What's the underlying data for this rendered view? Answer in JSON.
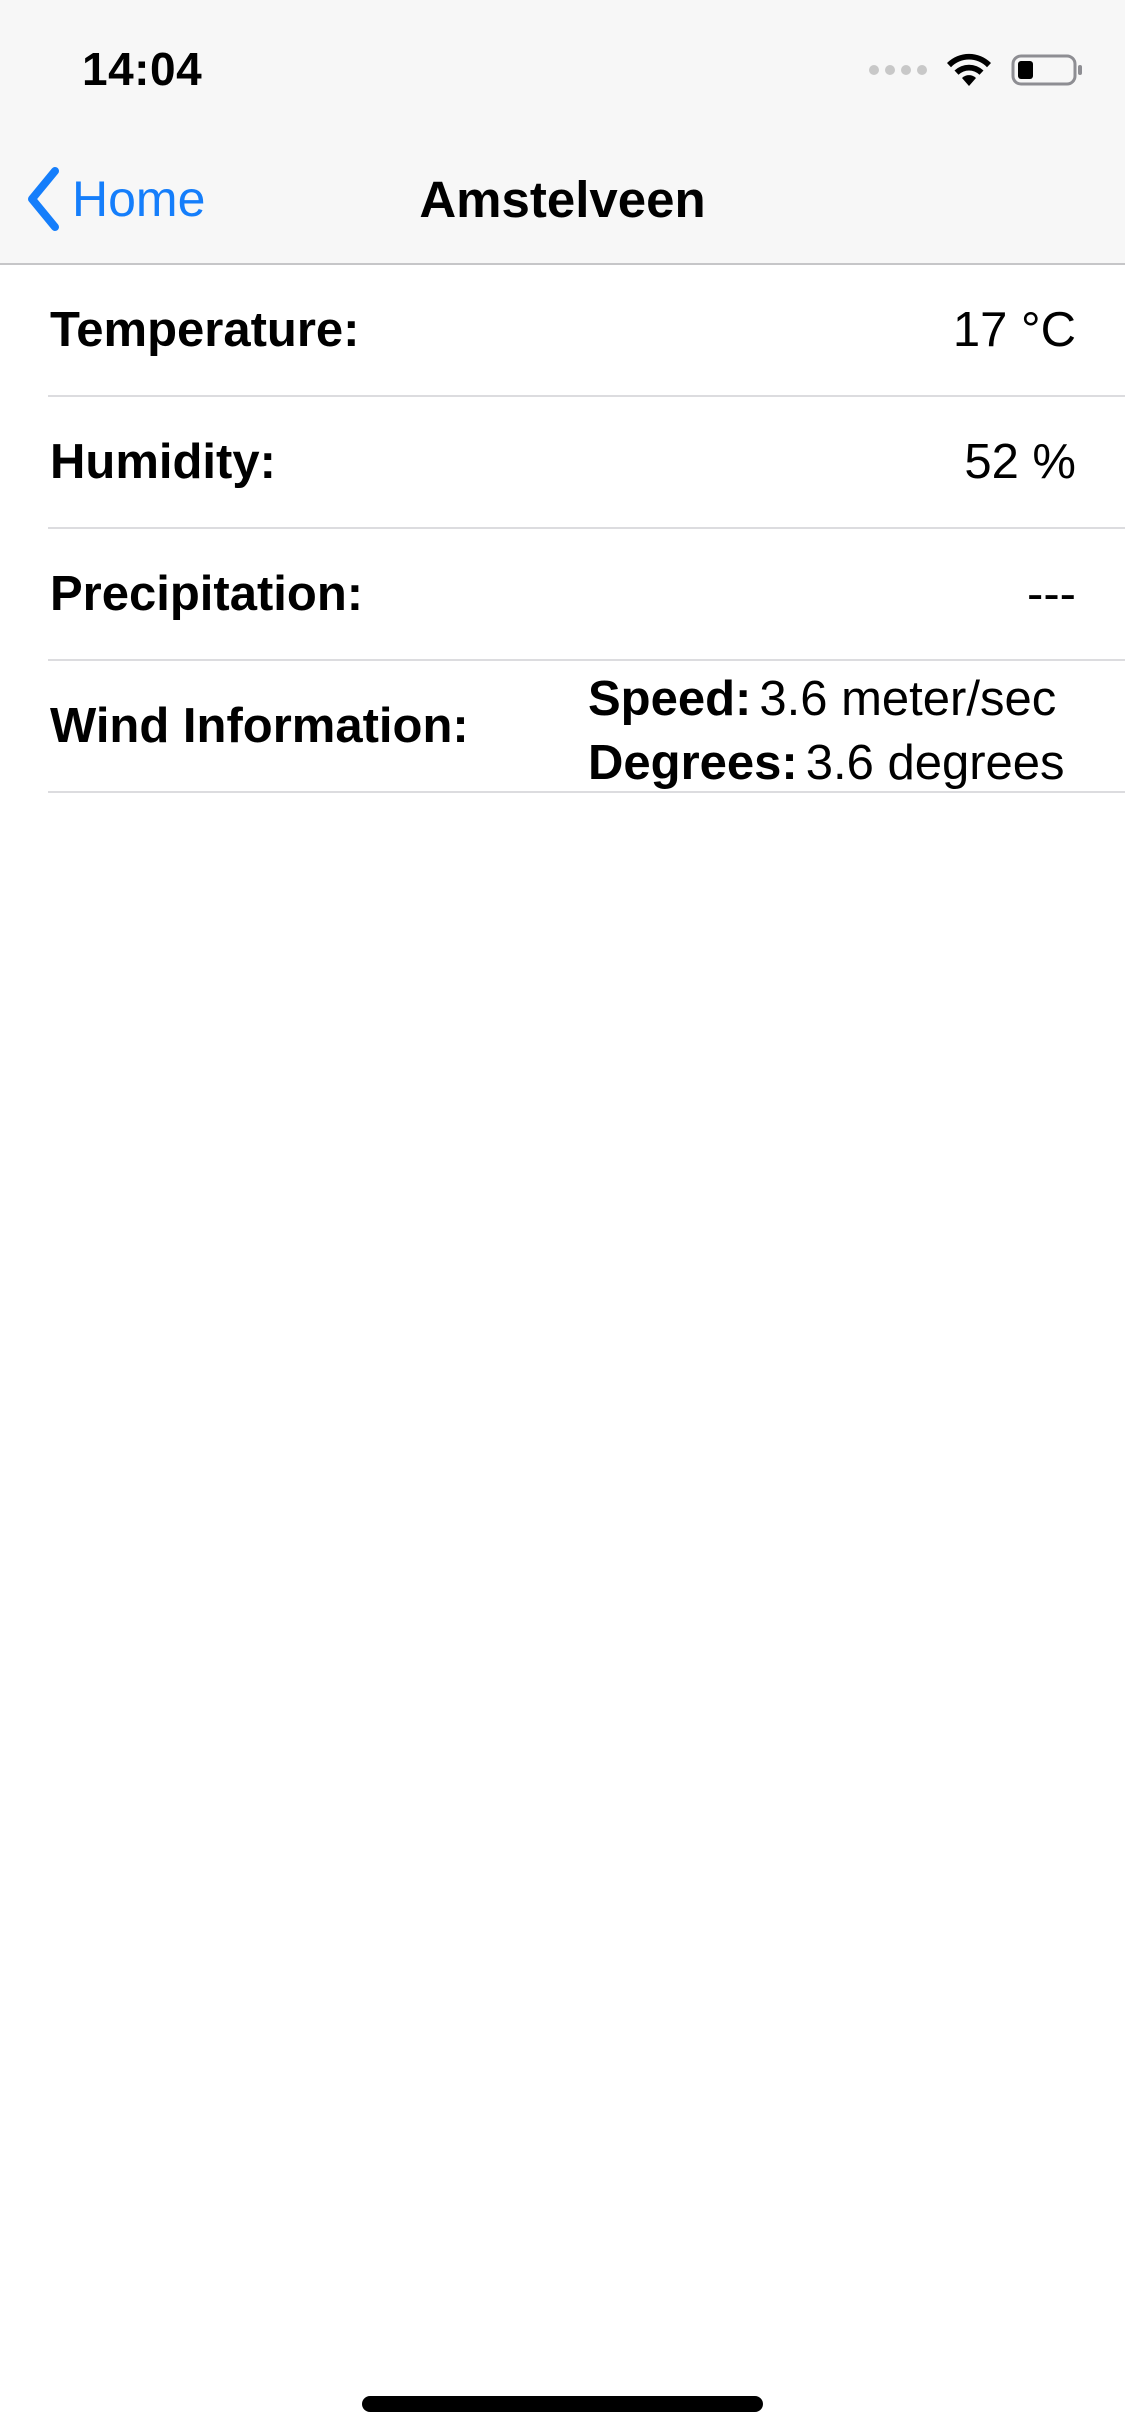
{
  "status_bar": {
    "time": "14:04"
  },
  "nav": {
    "back_label": "Home",
    "title": "Amstelveen",
    "accent_color": "#157efb"
  },
  "rows": {
    "temperature": {
      "label": "Temperature:",
      "value": "17 °C"
    },
    "humidity": {
      "label": "Humidity:",
      "value": "52 %"
    },
    "precipitation": {
      "label": "Precipitation:",
      "value": "---"
    },
    "wind": {
      "label": "Wind Information:",
      "speed_key": "Speed:",
      "speed_value": "3.6 meter/sec",
      "degrees_key": "Degrees:",
      "degrees_value": "3.6 degrees"
    }
  },
  "icons": {
    "signal": "signal-dots-icon",
    "wifi": "wifi-icon",
    "battery": "battery-icon",
    "back": "chevron-left-icon"
  }
}
